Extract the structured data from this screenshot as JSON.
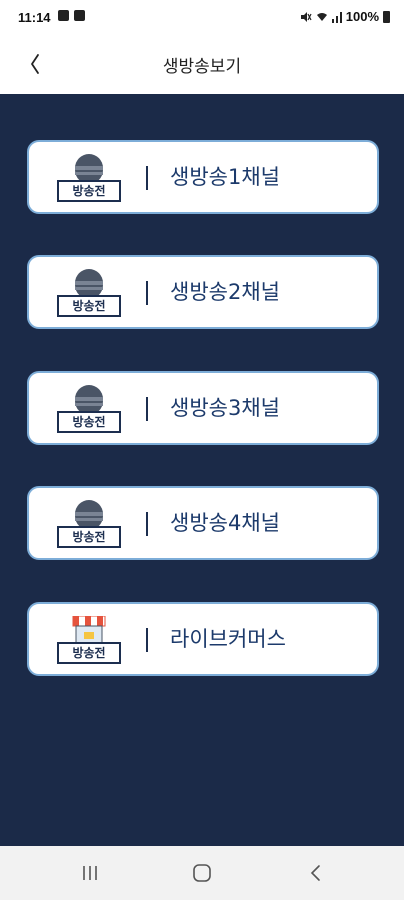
{
  "status_bar": {
    "time": "11:14",
    "battery": "100%",
    "icons": [
      "gallery-icon",
      "bag-icon",
      "mute-icon",
      "wifi-icon",
      "signal-icon",
      "battery-icon"
    ]
  },
  "header": {
    "title": "생방송보기",
    "back_icon": "chevron-left-icon"
  },
  "channels": [
    {
      "label": "생방송1채널",
      "badge": "방송전",
      "icon": "microphone-icon"
    },
    {
      "label": "생방송2채널",
      "badge": "방송전",
      "icon": "microphone-icon"
    },
    {
      "label": "생방송3채널",
      "badge": "방송전",
      "icon": "microphone-icon"
    },
    {
      "label": "생방송4채널",
      "badge": "방송전",
      "icon": "microphone-icon"
    },
    {
      "label": "라이브커머스",
      "badge": "방송전",
      "icon": "store-icon"
    }
  ],
  "nav_bar": {
    "icons": [
      "recent-apps-icon",
      "home-icon",
      "back-icon"
    ]
  },
  "colors": {
    "background": "#1b2a48",
    "card_border": "#7dadd8",
    "label_text": "#1c3a6b"
  }
}
